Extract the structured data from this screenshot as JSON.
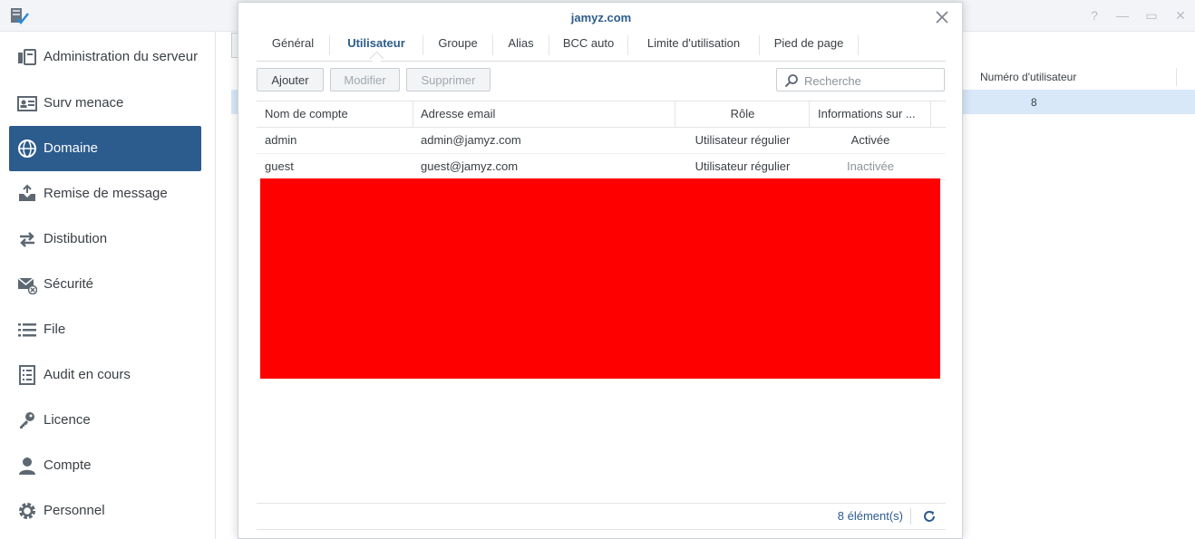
{
  "window": {
    "app_icon": "mail-server-icon",
    "controls": [
      "help-icon",
      "minimize-icon",
      "maximize-icon",
      "close-icon"
    ]
  },
  "sidebar": {
    "items": [
      {
        "label": "Administration du serveur",
        "icon": "server-admin-icon",
        "active": false
      },
      {
        "label": "Surv menace",
        "icon": "threat-monitor-icon",
        "active": false
      },
      {
        "label": "Domaine",
        "icon": "globe-icon",
        "active": true
      },
      {
        "label": "Remise de message",
        "icon": "inbox-delivery-icon",
        "active": false
      },
      {
        "label": "Distibution",
        "icon": "swap-arrows-icon",
        "active": false
      },
      {
        "label": "Sécurité",
        "icon": "mail-security-icon",
        "active": false
      },
      {
        "label": "File",
        "icon": "list-icon",
        "active": false
      },
      {
        "label": "Audit en cours",
        "icon": "audit-icon",
        "active": false
      },
      {
        "label": "Licence",
        "icon": "key-icon",
        "active": false
      },
      {
        "label": "Compte",
        "icon": "user-icon",
        "active": false
      },
      {
        "label": "Personnel",
        "icon": "gear-icon",
        "active": false
      }
    ]
  },
  "background_table": {
    "header": "Numéro d'utilisateur",
    "value": "8"
  },
  "dialog": {
    "title": "jamyz.com",
    "tabs": [
      "Général",
      "Utilisateur",
      "Groupe",
      "Alias",
      "BCC auto",
      "Limite d'utilisation",
      "Pied de page"
    ],
    "active_tab": "Utilisateur",
    "buttons": {
      "add": "Ajouter",
      "edit": "Modifier",
      "delete": "Supprimer"
    },
    "search": {
      "placeholder": "Recherche",
      "value": ""
    },
    "columns": [
      "Nom de compte",
      "Adresse email",
      "Rôle",
      "Informations sur ..."
    ],
    "rows": [
      {
        "account": "admin",
        "email": "admin@jamyz.com",
        "role": "Utilisateur régulier",
        "status": "Activée"
      },
      {
        "account": "guest",
        "email": "guest@jamyz.com",
        "role": "Utilisateur régulier",
        "status": "Inactivée"
      }
    ],
    "footer": {
      "count": "8 élément(s)"
    },
    "accent_color": "#2c5b8e",
    "redaction_color": "#ff0000"
  }
}
